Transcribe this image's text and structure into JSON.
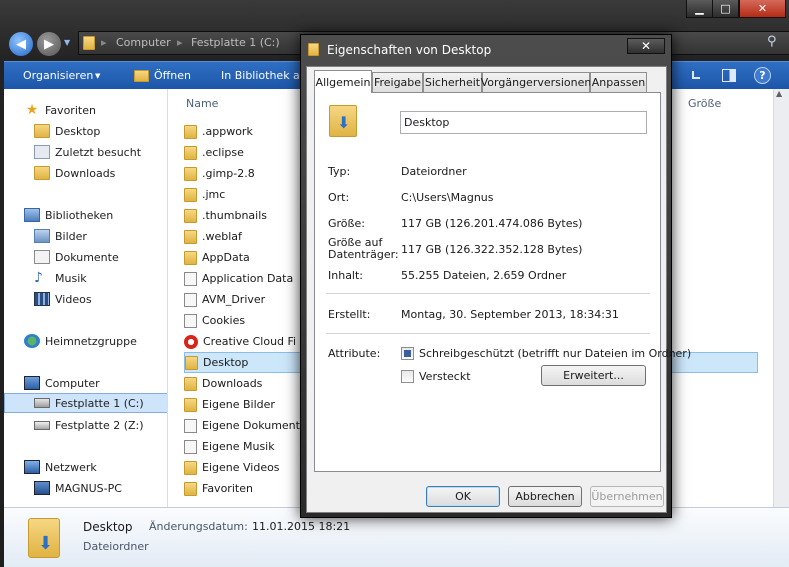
{
  "explorer": {
    "window_controls": {
      "minimize": "▁",
      "maximize": "□",
      "close": "✕"
    },
    "breadcrumb": [
      "Computer",
      "Festplatte 1 (C:)"
    ],
    "toolbar": {
      "organize": "Organisieren",
      "open": "Öffnen",
      "library": "In Bibliothek au"
    },
    "nav": {
      "favorites": "Favoriten",
      "fav_items": [
        "Desktop",
        "Zuletzt besucht",
        "Downloads"
      ],
      "libraries": "Bibliotheken",
      "lib_items": [
        "Bilder",
        "Dokumente",
        "Musik",
        "Videos"
      ],
      "homegroup": "Heimnetzgruppe",
      "computer": "Computer",
      "drives": [
        "Festplatte 1 (C:)",
        "Festplatte 2 (Z:)"
      ],
      "network": "Netzwerk",
      "pc": "MAGNUS-PC"
    },
    "columns": {
      "name": "Name",
      "size": "Größe"
    },
    "files": [
      ".appwork",
      ".eclipse",
      ".gimp-2.8",
      ".jmc",
      ".thumbnails",
      ".weblaf",
      "AppData",
      "Application Data",
      "AVM_Driver",
      "Cookies",
      "Creative Cloud Fi",
      "Desktop",
      "Downloads",
      "Eigene Bilder",
      "Eigene Dokument",
      "Eigene Musik",
      "Eigene Videos",
      "Favoriten"
    ],
    "details": {
      "name": "Desktop",
      "type": "Dateiordner",
      "modified_label": "Änderungsdatum:",
      "modified_value": "11.01.2015 18:21"
    }
  },
  "dialog": {
    "title": "Eigenschaften von Desktop",
    "close": "✕",
    "tabs": [
      "Allgemein",
      "Freigabe",
      "Sicherheit",
      "Vorgängerversionen",
      "Anpassen"
    ],
    "folder_name": "Desktop",
    "props": {
      "type_label": "Typ:",
      "type_value": "Dateiordner",
      "location_label": "Ort:",
      "location_value": "C:\\Users\\Magnus",
      "size_label": "Größe:",
      "size_value": "117 GB (126.201.474.086 Bytes)",
      "disksize_label_1": "Größe auf",
      "disksize_label_2": "Datenträger:",
      "disksize_value": "117 GB (126.322.352.128 Bytes)",
      "contents_label": "Inhalt:",
      "contents_value": "55.255 Dateien, 2.659 Ordner",
      "created_label": "Erstellt:",
      "created_value": "Montag, 30. September 2013, 18:34:31",
      "attributes_label": "Attribute:",
      "readonly_label": "Schreibgeschützt (betrifft nur Dateien im Ordner)",
      "hidden_label": "Versteckt",
      "advanced_button": "Erweitert..."
    },
    "buttons": {
      "ok": "OK",
      "cancel": "Abbrechen",
      "apply": "Übernehmen"
    }
  }
}
